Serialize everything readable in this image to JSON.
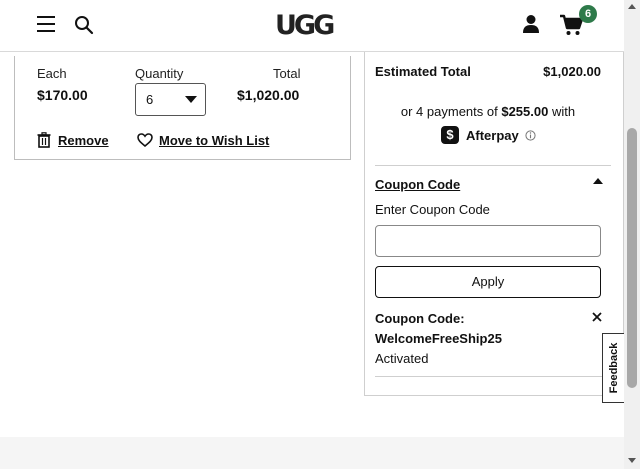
{
  "header": {
    "logo_text": "UGG",
    "cart_count": "6"
  },
  "cart_item": {
    "each_label": "Each",
    "each_value": "$170.00",
    "quantity_label": "Quantity",
    "quantity_value": "6",
    "total_label": "Total",
    "total_value": "$1,020.00",
    "remove_label": "Remove",
    "wishlist_label": "Move to Wish List"
  },
  "summary": {
    "estimated_total_label": "Estimated Total",
    "estimated_total_value": "$1,020.00",
    "afterpay_prefix": "or 4 payments of",
    "afterpay_amount": "$255.00",
    "afterpay_suffix": "with",
    "afterpay_brand": "Afterpay",
    "coupon_toggle_label": "Coupon Code",
    "coupon_field_label": "Enter Coupon Code",
    "coupon_input_value": "",
    "apply_label": "Apply",
    "applied_coupon_label": "Coupon Code:",
    "applied_coupon_code": "WelcomeFreeShip25",
    "applied_coupon_status": "Activated"
  },
  "feedback_label": "Feedback",
  "colors": {
    "badge": "#2e7a4a",
    "text": "#111111",
    "border": "#cfcfcf"
  }
}
